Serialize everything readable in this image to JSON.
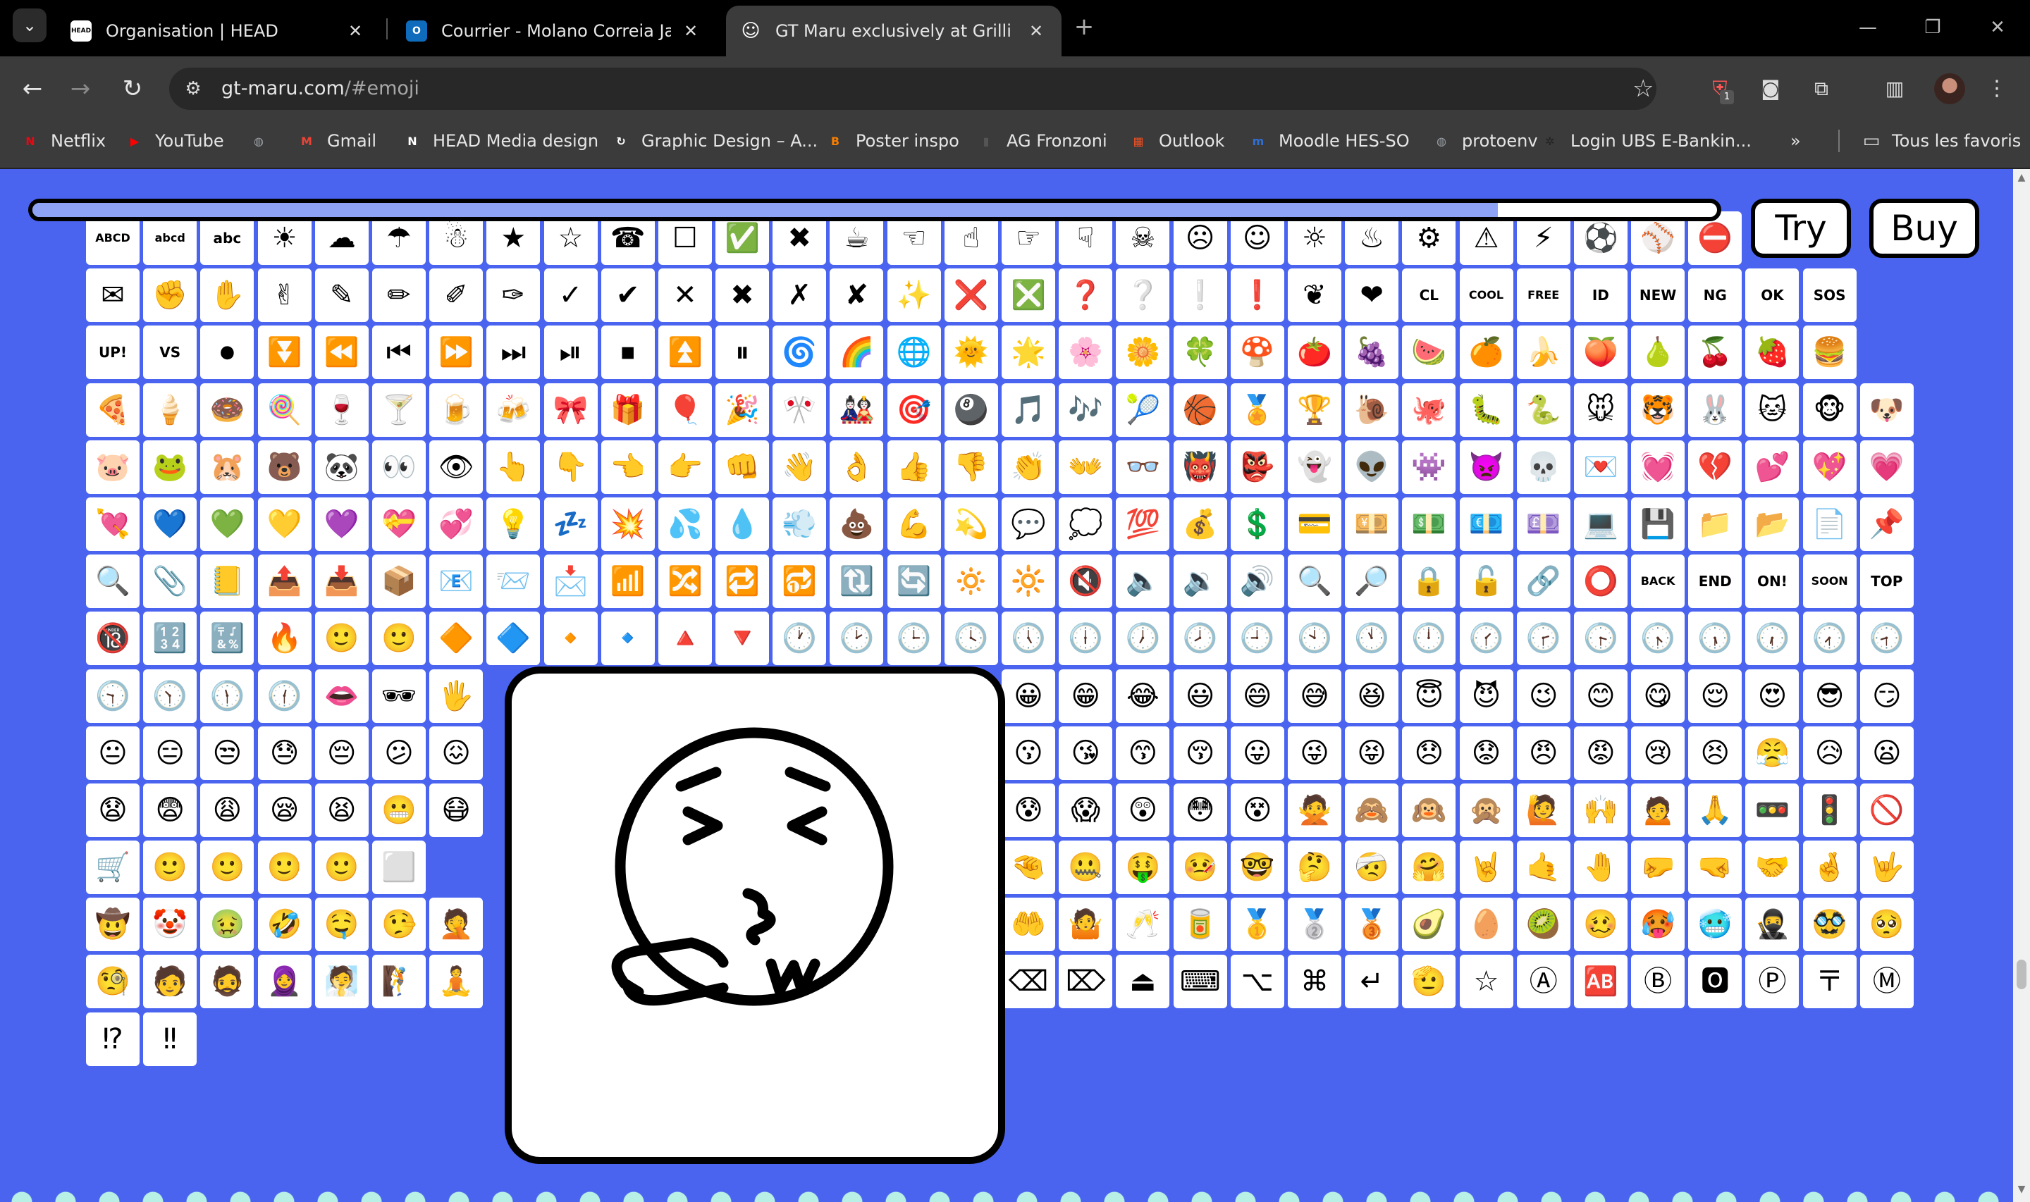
{
  "browser": {
    "tabs": [
      {
        "title": "Organisation | HEAD",
        "favicon_text": "HEAD"
      },
      {
        "title": "Courrier - Molano Correia Jasmi",
        "favicon_text": "O"
      },
      {
        "title": "GT Maru exclusively at Grilli Typ",
        "favicon_text": "☺"
      }
    ],
    "url_domain": "gt-maru.com",
    "url_rest": "/#emoji",
    "extension_badge": "1",
    "bookmarks": [
      {
        "label": "Netflix",
        "icon_text": "N",
        "color": "#e50914"
      },
      {
        "label": "YouTube",
        "icon_text": "▶",
        "color": "#ff0000"
      },
      {
        "label": "",
        "icon_text": "◍",
        "color": "#9aa0a6"
      },
      {
        "label": "Gmail",
        "icon_text": "M",
        "color": "#ea4335"
      },
      {
        "label": "HEAD Media design",
        "icon_text": "N",
        "color": "#ffffff"
      },
      {
        "label": "Graphic Design – A...",
        "icon_text": "↻",
        "color": "#ffffff"
      },
      {
        "label": "Poster inspo",
        "icon_text": "B",
        "color": "#f57d00"
      },
      {
        "label": "AG Fronzoni",
        "icon_text": "▮",
        "color": "#555555"
      },
      {
        "label": "Outlook",
        "icon_text": "▦",
        "color": "#f25022"
      },
      {
        "label": "Moodle HES-SO",
        "icon_text": "m",
        "color": "#2f6fd6"
      },
      {
        "label": "protoenv",
        "icon_text": "◍",
        "color": "#9aa0a6"
      },
      {
        "label": "Login UBS E-Bankin...",
        "icon_text": "✲",
        "color": "#222222"
      }
    ],
    "all_bookmarks": "Tous les favoris"
  },
  "page": {
    "background": "#4a64f0",
    "progress_fraction": 0.87,
    "try_label": "Try",
    "buy_label": "Buy",
    "preview_glyph": "sneezing-face",
    "emoji_rows": [
      [
        "ABCD",
        "abcd",
        "abc",
        "☀",
        "☁",
        "☂",
        "☃",
        "★",
        "☆",
        "☎",
        "☐",
        "✅",
        "✖",
        "☕",
        "☜",
        "☝",
        "☞",
        "☟",
        "☠",
        "☹",
        "☺",
        "☼",
        "♨",
        "⚙",
        "⚠",
        "⚡",
        "⚽",
        "⚾",
        "⛔",
        "",
        "",
        ""
      ],
      [
        "✉",
        "✊",
        "✋",
        "✌",
        "✎",
        "✏",
        "✐",
        "✑",
        "✓",
        "✔",
        "✕",
        "✖",
        "✗",
        "✘",
        "✨",
        "❌",
        "❎",
        "❓",
        "❔",
        "❕",
        "❗",
        "❦",
        "❤",
        "CL",
        "COOL",
        "FREE",
        "ID",
        "NEW",
        "NG",
        "OK",
        "SOS",
        ""
      ],
      [
        "UP!",
        "VS",
        "⏺",
        "⏬",
        "⏪",
        "⏮",
        "⏩",
        "⏭",
        "⏯",
        "⏹",
        "⏫",
        "⏸",
        "🌀",
        "🌈",
        "🌐",
        "🌞",
        "🌟",
        "🌸",
        "🌼",
        "🍀",
        "🍄",
        "🍅",
        "🍇",
        "🍉",
        "🍊",
        "🍌",
        "🍑",
        "🍐",
        "🍒",
        "🍓",
        "🍔",
        ""
      ],
      [
        "🍕",
        "🍦",
        "🍩",
        "🍭",
        "🍷",
        "🍸",
        "🍺",
        "🍻",
        "🎀",
        "🎁",
        "🎈",
        "🎉",
        "🎌",
        "🎎",
        "🎯",
        "🎱",
        "🎵",
        "🎶",
        "🎾",
        "🏀",
        "🏅",
        "🏆",
        "🐌",
        "🐙",
        "🐛",
        "🐍",
        "🐭",
        "🐯",
        "🐰",
        "🐱",
        "🐵",
        "🐶"
      ],
      [
        "🐷",
        "🐸",
        "🐹",
        "🐻",
        "🐼",
        "👀",
        "👁",
        "👆",
        "👇",
        "👈",
        "👉",
        "👊",
        "👋",
        "👌",
        "👍",
        "👎",
        "👏",
        "👐",
        "👓",
        "👹",
        "👺",
        "👻",
        "👽",
        "👾",
        "👿",
        "💀",
        "💌",
        "💓",
        "💔",
        "💕",
        "💖",
        "💗"
      ],
      [
        "💘",
        "💙",
        "💚",
        "💛",
        "💜",
        "💝",
        "💞",
        "💡",
        "💤",
        "💥",
        "💦",
        "💧",
        "💨",
        "💩",
        "💪",
        "💫",
        "💬",
        "💭",
        "💯",
        "💰",
        "💲",
        "💳",
        "💴",
        "💵",
        "💶",
        "💷",
        "💻",
        "💾",
        "📁",
        "📂",
        "📄",
        "📌"
      ],
      [
        "🔍",
        "📎",
        "📒",
        "📤",
        "📥",
        "📦",
        "📧",
        "📨",
        "📩",
        "📶",
        "🔀",
        "🔁",
        "🔂",
        "🔃",
        "🔄",
        "🔅",
        "🔆",
        "🔇",
        "🔈",
        "🔉",
        "🔊",
        "🔍",
        "🔎",
        "🔒",
        "🔓",
        "🔗",
        "⭕",
        "BACK",
        "END",
        "ON!",
        "SOON",
        "TOP"
      ],
      [
        "🔞",
        "🔢",
        "🔣",
        "🔥",
        "🙂",
        "🙂",
        "🔶",
        "🔷",
        "🔸",
        "🔹",
        "🔺",
        "🔻",
        "🕐",
        "🕑",
        "🕒",
        "🕓",
        "🕔",
        "🕕",
        "🕖",
        "🕗",
        "🕘",
        "🕙",
        "🕚",
        "🕛",
        "🕜",
        "🕝",
        "🕞",
        "🕟",
        "🕠",
        "🕡",
        "🕢",
        "🕣"
      ],
      [
        "🕤",
        "🕥",
        "🕦",
        "🕧",
        "👄",
        "🕶",
        "🖐",
        "",
        "",
        "",
        "",
        "",
        "",
        "",
        "",
        "",
        "😀",
        "😁",
        "😂",
        "😃",
        "😄",
        "😅",
        "😆",
        "😇",
        "😈",
        "😉",
        "😊",
        "😋",
        "😌",
        "😍",
        "😎",
        "😏"
      ],
      [
        "😐",
        "😑",
        "😒",
        "😓",
        "😔",
        "😕",
        "😖",
        "",
        "",
        "",
        "",
        "",
        "",
        "",
        "",
        "",
        "😗",
        "😘",
        "😙",
        "😚",
        "😛",
        "😜",
        "😝",
        "😞",
        "😟",
        "😠",
        "😡",
        "😢",
        "😣",
        "😤",
        "😥",
        "😦"
      ],
      [
        "😧",
        "😨",
        "😩",
        "😪",
        "😫",
        "😬",
        "😷",
        "",
        "",
        "",
        "",
        "",
        "",
        "",
        "",
        "",
        "😰",
        "😱",
        "😲",
        "😳",
        "😵",
        "🙅",
        "🙈",
        "🙉",
        "🙊",
        "🙋",
        "🙌",
        "🙍",
        "🙏",
        "🚥",
        "🚦",
        "🚫"
      ],
      [
        "🛒",
        "🙂",
        "🙂",
        "🙂",
        "🙂",
        "⬜",
        "",
        "",
        "",
        "",
        "",
        "",
        "",
        "",
        "",
        "",
        "🤏",
        "🤐",
        "🤑",
        "🤒",
        "🤓",
        "🤔",
        "🤕",
        "🤗",
        "🤘",
        "🤙",
        "🤚",
        "🤛",
        "🤜",
        "🤝",
        "🤞",
        "🤟"
      ],
      [
        "🤠",
        "🤡",
        "🤢",
        "🤣",
        "🤤",
        "🤥",
        "🤦",
        "",
        "",
        "",
        "",
        "",
        "",
        "",
        "",
        "",
        "🤲",
        "🤷",
        "🥂",
        "🥫",
        "🥇",
        "🥈",
        "🥉",
        "🥑",
        "🥚",
        "🥝",
        "🥴",
        "🥵",
        "🥶",
        "🥷",
        "🥸",
        "🥺"
      ],
      [
        "🧐",
        "🧑",
        "🧔",
        "🧕",
        "🧖",
        "🧗",
        "🧘",
        "",
        "",
        "",
        "",
        "",
        "",
        "",
        "",
        "",
        "⌫",
        "⌦",
        "⏏",
        "⌨",
        "⌥",
        "⌘",
        "↵",
        "🫡",
        "☆",
        "Ⓐ",
        "🆎",
        "Ⓑ",
        "🅾",
        "Ⓟ",
        "〒",
        "Ⓜ"
      ],
      [
        "⁉",
        "‼"
      ]
    ]
  }
}
